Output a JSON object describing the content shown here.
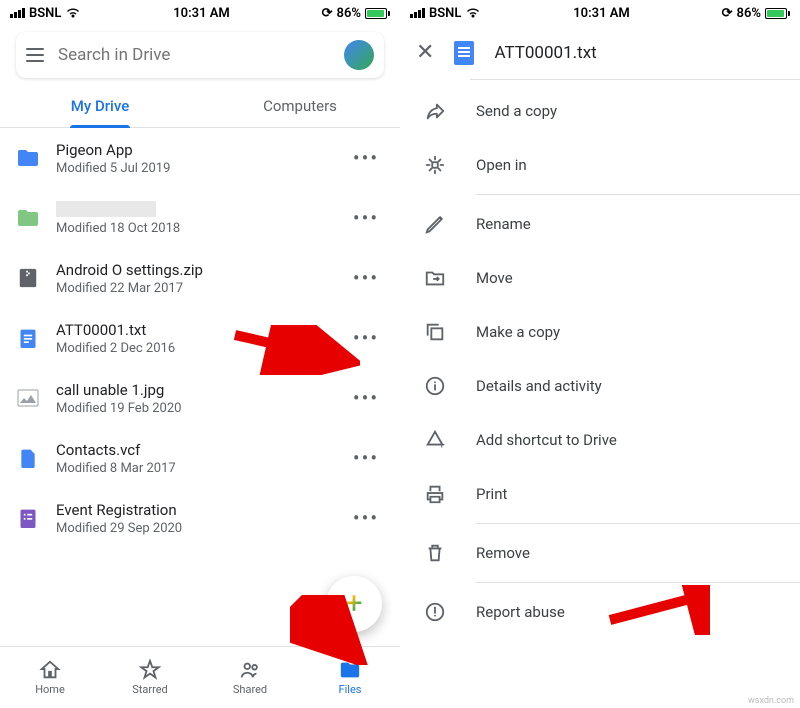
{
  "status": {
    "carrier": "BSNL",
    "time": "10:31 AM",
    "battery": "86%"
  },
  "left": {
    "search_placeholder": "Search in Drive",
    "tabs": {
      "my_drive": "My Drive",
      "computers": "Computers"
    },
    "files": [
      {
        "name": "Pigeon App",
        "meta": "Modified 5 Jul 2019",
        "icon": "folder-blue"
      },
      {
        "name": "",
        "meta": "Modified 18 Oct 2018",
        "icon": "folder-green",
        "redacted": true
      },
      {
        "name": "Android O settings.zip",
        "meta": "Modified 22 Mar 2017",
        "icon": "zip"
      },
      {
        "name": "ATT00001.txt",
        "meta": "Modified 2 Dec 2016",
        "icon": "doc"
      },
      {
        "name": "call unable 1.jpg",
        "meta": "Modified 19 Feb 2020",
        "icon": "image"
      },
      {
        "name": "Contacts.vcf",
        "meta": "Modified 8 Mar 2017",
        "icon": "vcf"
      },
      {
        "name": "Event Registration",
        "meta": "Modified 29 Sep 2020",
        "icon": "form"
      }
    ],
    "nav": {
      "home": "Home",
      "starred": "Starred",
      "shared": "Shared",
      "files": "Files"
    }
  },
  "right": {
    "title": "ATT00001.txt",
    "menu": {
      "send_copy": "Send a copy",
      "open_in": "Open in",
      "rename": "Rename",
      "move": "Move",
      "make_copy": "Make a copy",
      "details": "Details and activity",
      "add_shortcut": "Add shortcut to Drive",
      "print": "Print",
      "remove": "Remove",
      "report": "Report abuse"
    }
  },
  "watermark": "wsxdn.com"
}
